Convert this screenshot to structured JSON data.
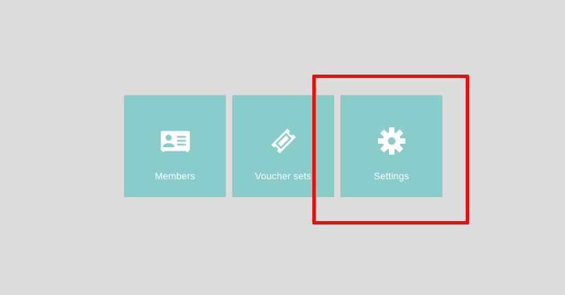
{
  "tiles": [
    {
      "id": "members",
      "label": "Members",
      "icon": "id-card-icon"
    },
    {
      "id": "voucher-sets",
      "label": "Voucher sets",
      "icon": "ticket-icon"
    },
    {
      "id": "settings",
      "label": "Settings",
      "icon": "gear-icon"
    }
  ],
  "colors": {
    "background": "#dcdcdc",
    "tile": "#89cdcb",
    "tile_text": "#ffffff",
    "highlight": "#ee0d09"
  },
  "highlight": {
    "target": "settings"
  }
}
